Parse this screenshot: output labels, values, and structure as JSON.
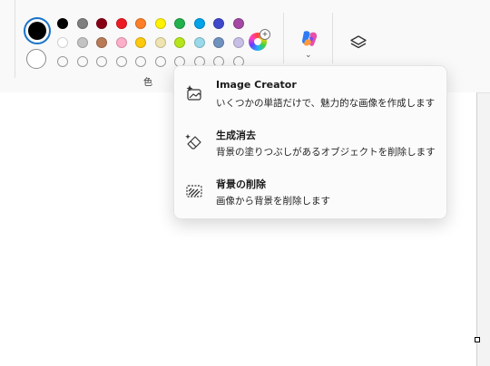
{
  "palette": {
    "label": "色",
    "swatches_row1": [
      "#000000",
      "#7f7f7f",
      "#880015",
      "#ed1c24",
      "#ff7f27",
      "#fff200",
      "#22b14c",
      "#00a2e8",
      "#3f48cc",
      "#a349a4"
    ],
    "swatches_row2": [
      "#ffffff",
      "#c3c3c3",
      "#b97a57",
      "#ffaec9",
      "#ffc90e",
      "#efe4b0",
      "#b5e61d",
      "#99d9ea",
      "#7092be",
      "#c8bfe7"
    ],
    "empty_row_count": 10,
    "color1": "#000000",
    "color2": "#ffffff"
  },
  "icons": {
    "edit_colors": "edit-colors-icon",
    "copilot": "copilot-icon",
    "layers": "layers-icon"
  },
  "menu": {
    "items": [
      {
        "title": "Image Creator",
        "desc": "いくつかの単語だけで、魅力的な画像を作成します",
        "icon": "image-creator-icon"
      },
      {
        "title": "生成消去",
        "desc": "背景の塗りつぶしがあるオブジェクトを削除します",
        "icon": "generative-erase-icon"
      },
      {
        "title": "背景の削除",
        "desc": "画像から背景を削除します",
        "icon": "remove-background-icon"
      }
    ]
  }
}
